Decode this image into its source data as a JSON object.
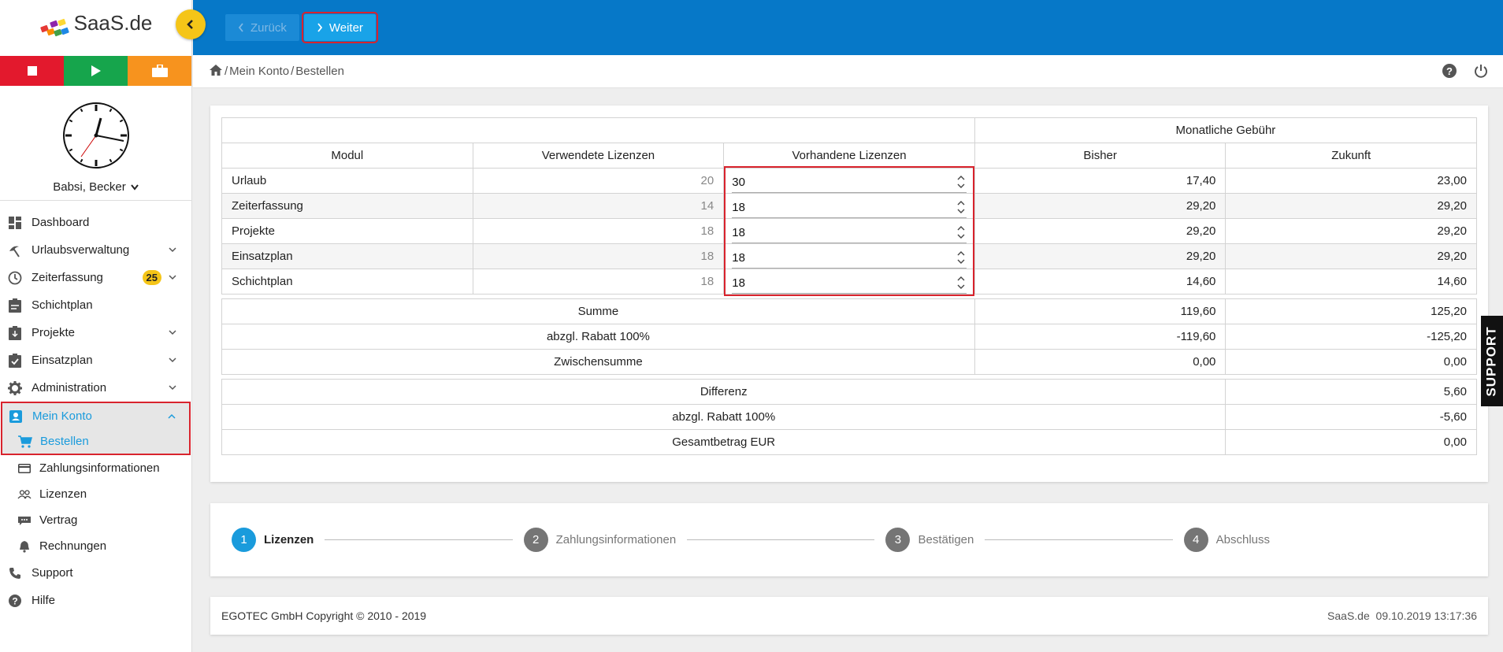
{
  "brand": {
    "logo_text": "SaaS.de"
  },
  "user": {
    "name": "Babsi, Becker"
  },
  "nav": {
    "items": [
      {
        "label": "Dashboard"
      },
      {
        "label": "Urlaubsverwaltung"
      },
      {
        "label": "Zeiterfassung",
        "badge": "25"
      },
      {
        "label": "Schichtplan"
      },
      {
        "label": "Projekte"
      },
      {
        "label": "Einsatzplan"
      },
      {
        "label": "Administration"
      },
      {
        "label": "Mein Konto"
      }
    ],
    "sub_items": [
      {
        "label": "Bestellen"
      },
      {
        "label": "Zahlungsinformationen"
      },
      {
        "label": "Lizenzen"
      },
      {
        "label": "Vertrag"
      },
      {
        "label": "Rechnungen"
      }
    ],
    "tail_items": [
      {
        "label": "Support"
      },
      {
        "label": "Hilfe"
      }
    ]
  },
  "header": {
    "back_label": "Zurück",
    "next_label": "Weiter"
  },
  "breadcrumb": {
    "sep1": "/",
    "part1": "Mein Konto",
    "sep2": "/",
    "part2": "Bestellen"
  },
  "table": {
    "group_header": "Monatliche Gebühr",
    "col_modul": "Modul",
    "col_used": "Verwendete Lizenzen",
    "col_avail": "Vorhandene Lizenzen",
    "col_bisher": "Bisher",
    "col_zukunft": "Zukunft",
    "rows": [
      {
        "modul": "Urlaub",
        "used": "20",
        "avail": "30",
        "bisher": "17,40",
        "zukunft": "23,00"
      },
      {
        "modul": "Zeiterfassung",
        "used": "14",
        "avail": "18",
        "bisher": "29,20",
        "zukunft": "29,20"
      },
      {
        "modul": "Projekte",
        "used": "18",
        "avail": "18",
        "bisher": "29,20",
        "zukunft": "29,20"
      },
      {
        "modul": "Einsatzplan",
        "used": "18",
        "avail": "18",
        "bisher": "29,20",
        "zukunft": "29,20"
      },
      {
        "modul": "Schichtplan",
        "used": "18",
        "avail": "18",
        "bisher": "14,60",
        "zukunft": "14,60"
      }
    ],
    "summary": [
      {
        "label": "Summe",
        "bisher": "119,60",
        "zukunft": "125,20"
      },
      {
        "label": "abzgl. Rabatt 100%",
        "bisher": "-119,60",
        "zukunft": "-125,20"
      },
      {
        "label": "Zwischensumme",
        "bisher": "0,00",
        "zukunft": "0,00"
      }
    ],
    "totals": [
      {
        "label": "Differenz",
        "value": "5,60"
      },
      {
        "label": "abzgl. Rabatt 100%",
        "value": "-5,60"
      },
      {
        "label": "Gesamtbetrag EUR",
        "value": "0,00"
      }
    ]
  },
  "stepper": [
    {
      "num": "1",
      "label": "Lizenzen"
    },
    {
      "num": "2",
      "label": "Zahlungsinformationen"
    },
    {
      "num": "3",
      "label": "Bestätigen"
    },
    {
      "num": "4",
      "label": "Abschluss"
    }
  ],
  "footer": {
    "copyright": "EGOTEC GmbH Copyright © 2010 - 2019",
    "brand": "SaaS.de",
    "datetime": "09.10.2019 13:17:36"
  },
  "support_tab": "SUPPORT",
  "colors": {
    "primary": "#0678c8",
    "accent": "#1a9bdc",
    "highlight": "#d9232d",
    "badge": "#f5c518"
  }
}
